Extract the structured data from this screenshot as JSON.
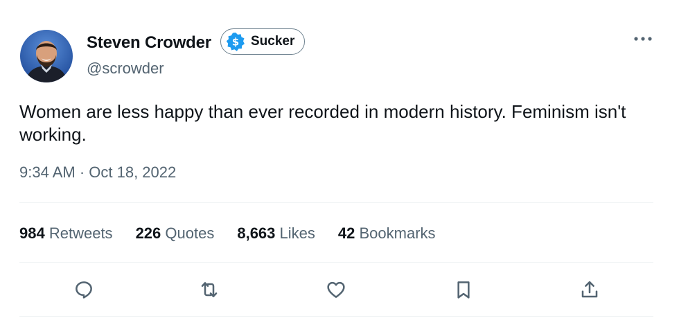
{
  "author": {
    "name": "Steven Crowder",
    "handle": "@scrowder",
    "badge_label": "Sucker"
  },
  "tweet": {
    "text": "Women are less happy than ever recorded in modern history. Feminism isn't working.",
    "timestamp": "9:34 AM · Oct 18, 2022"
  },
  "stats": [
    {
      "count": "984",
      "label": "Retweets"
    },
    {
      "count": "226",
      "label": "Quotes"
    },
    {
      "count": "8,663",
      "label": "Likes"
    },
    {
      "count": "42",
      "label": "Bookmarks"
    }
  ],
  "actions": [
    "reply-icon",
    "retweet-icon",
    "like-icon",
    "bookmark-icon",
    "share-icon"
  ],
  "colors": {
    "text": "#0f1419",
    "secondary": "#536471",
    "badge_blue": "#1d9bf0",
    "divider": "#eff3f4"
  }
}
